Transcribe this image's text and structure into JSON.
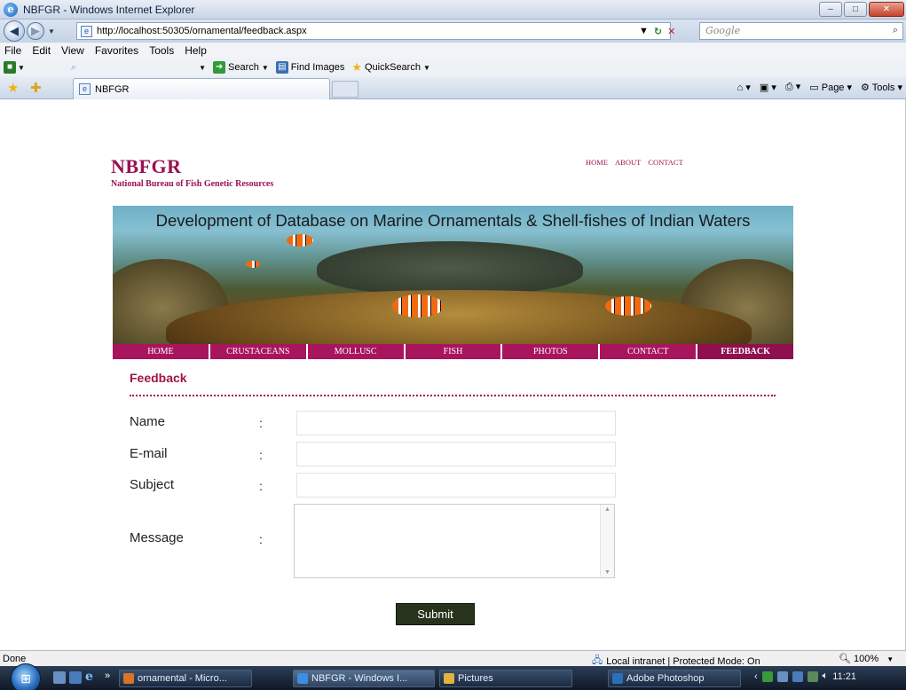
{
  "window": {
    "title": "NBFGR - Windows Internet Explorer",
    "controls": [
      "–",
      "□",
      "✕"
    ]
  },
  "address_bar": {
    "url": "http://localhost:50305/ornamental/feedback.aspx",
    "refresh": "↻",
    "stop": "✕",
    "search_placeholder": "Google"
  },
  "menu": {
    "items": [
      "File",
      "Edit",
      "View",
      "Favorites",
      "Tools",
      "Help"
    ]
  },
  "search_toolbar": {
    "search_label": "Search",
    "find_images_label": "Find Images",
    "quicksearch_label": "QuickSearch"
  },
  "tab": {
    "title": "NBFGR"
  },
  "command_bar": {
    "page_label": "Page",
    "tools_label": "Tools"
  },
  "site": {
    "brand": "NBFGR",
    "brand_sub": "National Bureau of Fish Genetic Resources",
    "top_links": [
      "HOME",
      "ABOUT",
      "CONTACT"
    ],
    "banner_title": "Development of Database on Marine Ornamentals & Shell-fishes of Indian Waters",
    "nav": [
      "HOME",
      "CRUSTACEANS",
      "MOLLUSC",
      "FISH",
      "PHOTOS",
      "CONTACT",
      "FEEDBACK"
    ],
    "nav_active": "FEEDBACK"
  },
  "form": {
    "heading": "Feedback",
    "fields": [
      {
        "label": "Name",
        "colon": ":",
        "value": ""
      },
      {
        "label": "E-mail",
        "colon": ":",
        "value": ""
      },
      {
        "label": "Subject",
        "colon": ":",
        "value": ""
      },
      {
        "label": "Message",
        "colon": ":",
        "value": ""
      }
    ],
    "submit_label": "Submit"
  },
  "status_bar": {
    "status": "Done",
    "zone": "Local intranet | Protected Mode: On",
    "zoom": "100%"
  },
  "taskbar": {
    "buttons": [
      {
        "label": "ornamental - Micro...",
        "icon_color": "#d9732a"
      },
      {
        "label": "NBFGR - Windows I...",
        "icon_color": "#3d8de0"
      },
      {
        "label": "Pictures",
        "icon_color": "#e2b341"
      },
      {
        "label": "Adobe Photoshop",
        "icon_color": "#2a6fb8"
      }
    ],
    "clock": "11:21"
  },
  "colors": {
    "brand": "#9a1250",
    "nav_bg": "#a8155e",
    "heading": "#a01545",
    "submit_bg": "#28331d"
  }
}
